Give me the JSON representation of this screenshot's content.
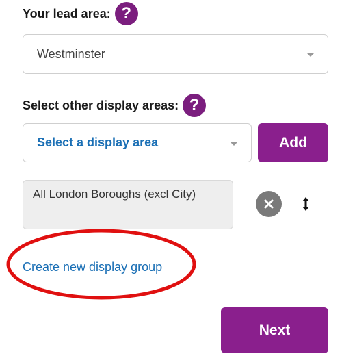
{
  "lead_area": {
    "label": "Your lead area:",
    "help_icon": "question-mark",
    "selected": "Westminster"
  },
  "display_areas": {
    "label": "Select other display areas:",
    "help_icon": "question-mark",
    "placeholder": "Select a display area",
    "add_label": "Add",
    "selected_items": [
      {
        "label": "All London Boroughs (excl City)"
      }
    ]
  },
  "create_group_link": "Create new display group",
  "next_label": "Next",
  "colors": {
    "brand_purple": "#8a1f8d",
    "link_blue": "#1a6fb5",
    "highlight_red": "#e01010"
  }
}
